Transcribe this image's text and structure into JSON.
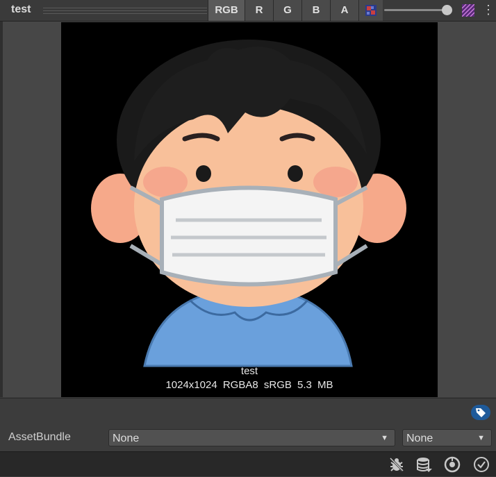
{
  "toolbar": {
    "title": "test",
    "channels": {
      "rgb": "RGB",
      "r": "R",
      "g": "G",
      "b": "B",
      "a": "A"
    },
    "mip_icon": "mipmap-icon",
    "alpha_icon": "checker-alpha-icon",
    "menu_icon": "kebab-menu-icon"
  },
  "preview": {
    "image_name": "test",
    "image_info": "1024x1024 RGBA8 sRGB 5.3 MB"
  },
  "asset_bundle": {
    "label": "AssetBundle",
    "name_value": "None",
    "variant_value": "None"
  },
  "status_icons": [
    "bug-icon",
    "cache-server-icon",
    "eye-icon",
    "checkmark-icon"
  ],
  "colors": {
    "panel_bg": "#3c3c3c",
    "toolbar_bg": "#3a3a3a",
    "canvas_bg": "#000000",
    "label_button": "#1e5a9a",
    "status_bar": "#282828"
  }
}
